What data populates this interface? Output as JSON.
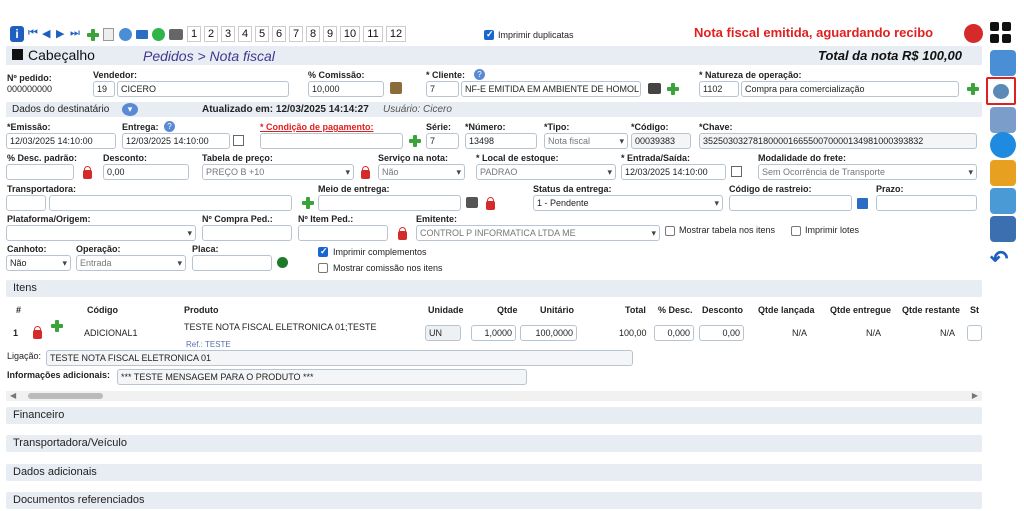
{
  "toolbar": {
    "pages": [
      "1",
      "2",
      "3",
      "4",
      "5",
      "6",
      "7",
      "8",
      "9",
      "10",
      "11",
      "12"
    ],
    "print_duplicates_label": "Imprimir duplicatas",
    "status_message": "Nota fiscal emitida, aguardando recibo"
  },
  "header": {
    "title": "Cabeçalho",
    "breadcrumb": "Pedidos > Nota fiscal",
    "total_label": "Total da nota R$ 100,00"
  },
  "order": {
    "order_no_label": "Nº pedido:",
    "order_no": "000000000",
    "vendor_label": "Vendedor:",
    "vendor_code": "19",
    "vendor_name": "CICERO",
    "commission_label": "% Comissão:",
    "commission": "10,000",
    "client_label": "* Cliente:",
    "client_code": "7",
    "client_name": "NF-E EMITIDA EM AMBIENTE DE HOMOL",
    "nature_label": "* Natureza de operação:",
    "nature_code": "1102",
    "nature_name": "Compra para comercialização"
  },
  "recipient": {
    "label": "Dados do destinatário",
    "updated": "Atualizado em: 12/03/2025 14:14:27",
    "user": "Usuário: Cicero"
  },
  "fields": {
    "emissao_label": "*Emissão:",
    "emissao": "12/03/2025 14:10:00",
    "entrega_label": "Entrega:",
    "entrega": "12/03/2025 14:10:00",
    "cond_pag_label": "* Condição de pagamento:",
    "serie_label": "Série:",
    "serie": "7",
    "numero_label": "*Número:",
    "numero": "13498",
    "tipo_label": "*Tipo:",
    "tipo": "Nota fiscal",
    "codigo_label": "*Código:",
    "codigo": "00039383",
    "chave_label": "*Chave:",
    "chave": "35250303278180000166550070000134981000393832",
    "desc_padrao_label": "% Desc. padrão:",
    "desconto_label": "Desconto:",
    "desconto": "0,00",
    "tabela_preco_label": "Tabela de preço:",
    "tabela_preco": "PREÇO B +10",
    "servico_label": "Serviço na nota:",
    "servico": "Não",
    "local_estoque_label": "* Local de estoque:",
    "local_estoque": "PADRAO",
    "entrada_saida_label": "* Entrada/Saída:",
    "entrada_saida": "12/03/2025 14:10:00",
    "modalidade_label": "Modalidade do frete:",
    "modalidade": "Sem Ocorrência de Transporte",
    "transportadora_label": "Transportadora:",
    "meio_entrega_label": "Meio de entrega:",
    "status_entrega_label": "Status da entrega:",
    "status_entrega": "1 - Pendente",
    "rastreio_label": "Código de rastreio:",
    "prazo_label": "Prazo:",
    "plataforma_label": "Plataforma/Origem:",
    "compra_ped_label": "Nº Compra Ped.:",
    "item_ped_label": "Nº Item Ped.:",
    "emitente_label": "Emitente:",
    "emitente": "CONTROL P INFORMATICA LTDA ME",
    "mostrar_tabela_label": "Mostrar tabela nos itens",
    "imprimir_lotes_label": "Imprimir lotes",
    "canhoto_label": "Canhoto:",
    "canhoto": "Não",
    "operacao_label": "Operação:",
    "operacao": "Entrada",
    "placa_label": "Placa:",
    "imprimir_complementos_label": "Imprimir complementos",
    "mostrar_comissao_label": "Mostrar comissão nos itens"
  },
  "items": {
    "section_label": "Itens",
    "columns": [
      "#",
      "Código",
      "Produto",
      "Unidade",
      "Qtde",
      "Unitário",
      "Total",
      "% Desc.",
      "Desconto",
      "Qtde lançada",
      "Qtde entregue",
      "Qtde restante",
      "St"
    ],
    "row": {
      "num": "1",
      "code": "ADICIONAL1",
      "product": "TESTE NOTA FISCAL ELETRONICA 01;TESTE",
      "ref": "Ref.: TESTE",
      "unit": "UN",
      "qty": "1,0000",
      "unit_price": "100,0000",
      "total": "100,00",
      "desc_pct": "0,000",
      "discount": "0,00",
      "qty_launched": "N/A",
      "qty_delivered": "N/A",
      "qty_remaining": "N/A"
    },
    "link_label": "Ligação:",
    "link_value": "TESTE NOTA FISCAL ELETRONICA 01",
    "info_label": "Informações adicionais:",
    "info_value": "*** TESTE MENSAGEM PARA O PRODUTO ***"
  },
  "sections": [
    "Financeiro",
    "Transportadora/Veículo",
    "Dados adicionais",
    "Documentos referenciados"
  ],
  "colors": {
    "accent": "#3b3b8f",
    "status": "#e02020",
    "section_bg": "#e8edf3",
    "plus": "#3aa33a"
  }
}
